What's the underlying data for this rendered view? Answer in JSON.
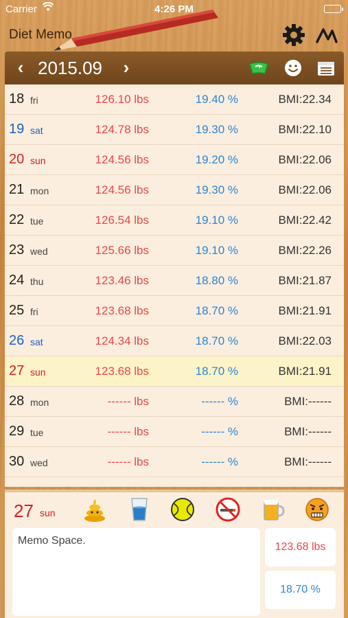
{
  "status_bar": {
    "carrier": "Carrier",
    "time": "4:26 PM"
  },
  "app": {
    "title": "Diet Memo"
  },
  "nav": {
    "prev": "‹",
    "month": "2015.09",
    "next": "›"
  },
  "icons": {
    "gear": "gear-icon",
    "graph": "graph-icon",
    "scale": "scale-icon",
    "smile": "smile-icon",
    "calendar": "calendar-icon"
  },
  "rows": [
    {
      "day": "18",
      "dow": "fri",
      "weight": "126.10 lbs",
      "fat": "19.40 %",
      "bmi": "BMI:22.34"
    },
    {
      "day": "19",
      "dow": "sat",
      "weight": "124.78 lbs",
      "fat": "19.30 %",
      "bmi": "BMI:22.10"
    },
    {
      "day": "20",
      "dow": "sun",
      "weight": "124.56 lbs",
      "fat": "19.20 %",
      "bmi": "BMI:22.06"
    },
    {
      "day": "21",
      "dow": "mon",
      "weight": "124.56 lbs",
      "fat": "19.30 %",
      "bmi": "BMI:22.06"
    },
    {
      "day": "22",
      "dow": "tue",
      "weight": "126.54 lbs",
      "fat": "19.10 %",
      "bmi": "BMI:22.42"
    },
    {
      "day": "23",
      "dow": "wed",
      "weight": "125.66 lbs",
      "fat": "19.10 %",
      "bmi": "BMI:22.26"
    },
    {
      "day": "24",
      "dow": "thu",
      "weight": "123.46 lbs",
      "fat": "18.80 %",
      "bmi": "BMI:21.87"
    },
    {
      "day": "25",
      "dow": "fri",
      "weight": "123.68 lbs",
      "fat": "18.70 %",
      "bmi": "BMI:21.91"
    },
    {
      "day": "26",
      "dow": "sat",
      "weight": "124.34 lbs",
      "fat": "18.70 %",
      "bmi": "BMI:22.03"
    },
    {
      "day": "27",
      "dow": "sun",
      "weight": "123.68 lbs",
      "fat": "18.70 %",
      "bmi": "BMI:21.91"
    },
    {
      "day": "28",
      "dow": "mon",
      "weight": "------ lbs",
      "fat": "------ %",
      "bmi": "BMI:------"
    },
    {
      "day": "29",
      "dow": "tue",
      "weight": "------ lbs",
      "fat": "------ %",
      "bmi": "BMI:------"
    },
    {
      "day": "30",
      "dow": "wed",
      "weight": "------ lbs",
      "fat": "------ %",
      "bmi": "BMI:------"
    }
  ],
  "detail": {
    "day": "27",
    "dow": "sun",
    "memo": "Memo Space.",
    "weight": "123.68 lbs",
    "fat": "18.70 %",
    "stamps": [
      "poop-icon",
      "water-glass-icon",
      "tennis-ball-icon",
      "no-smoking-icon",
      "beer-mug-icon",
      "angry-face-icon"
    ]
  },
  "colors": {
    "weight": "#e8474b",
    "fat": "#2a86d6",
    "saturday": "#1c5fc4",
    "sunday": "#d42020",
    "nav": "#7a4e22"
  }
}
